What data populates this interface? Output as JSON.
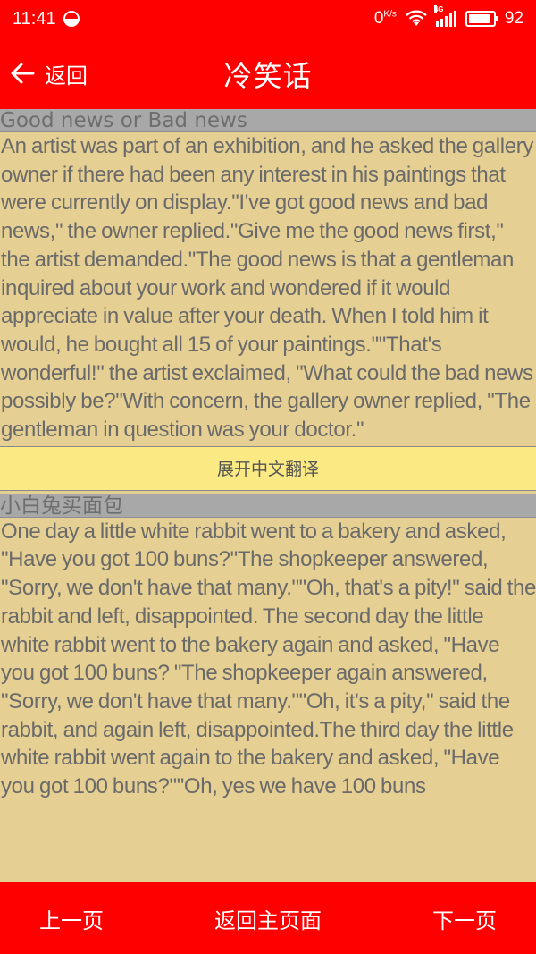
{
  "status_bar": {
    "time": "11:41",
    "net_speed": "0",
    "net_speed_unit": "K/s",
    "network_type": "4G",
    "battery_level": "92",
    "battery_fraction": 0.92
  },
  "header": {
    "back_label": "返回",
    "title": "冷笑话"
  },
  "jokes": [
    {
      "title": "Good news or Bad news",
      "body": "An artist was part of an exhibition, and he asked the gallery owner if there had been any interest in his paintings that were currently on display.\"I've got good news and bad news,\" the owner replied.\"Give me the good news first,\" the artist demanded.\"The good news is that a gentleman inquired about your work and wondered if it would appreciate in value after your death. When I told him it would, he bought all 15 of your paintings.\"\"That's wonderful!\" the artist exclaimed, \"What could the bad news possibly be?\"With concern, the gallery owner replied, \"The gentleman in question was your doctor.\"",
      "translate_label": "展开中文翻译"
    },
    {
      "title": "小白兔买面包",
      "body": "One day a little white rabbit went to a bakery and asked, \"Have you got 100 buns?\"The shopkeeper answered, \"Sorry, we don't have that many.\"\"Oh, that's a pity!\" said the rabbit and left, disappointed. The second day the little white rabbit went to the bakery again and asked, \"Have you got 100 buns? \"The shopkeeper again answered, \"Sorry, we don't have that many.\"\"Oh, it's a pity,\" said the rabbit, and again left, disappointed.The third day the little white rabbit went again to the bakery and asked, \"Have you got 100 buns?\"\"Oh, yes we have 100 buns"
    }
  ],
  "bottom_nav": {
    "prev_label": "上一页",
    "home_label": "返回主页面",
    "next_label": "下一页"
  },
  "colors": {
    "accent": "#ff0000",
    "content_bg": "#e6cf92",
    "title_bar_bg": "#a8a8a8",
    "translate_bg": "#fbe983"
  }
}
